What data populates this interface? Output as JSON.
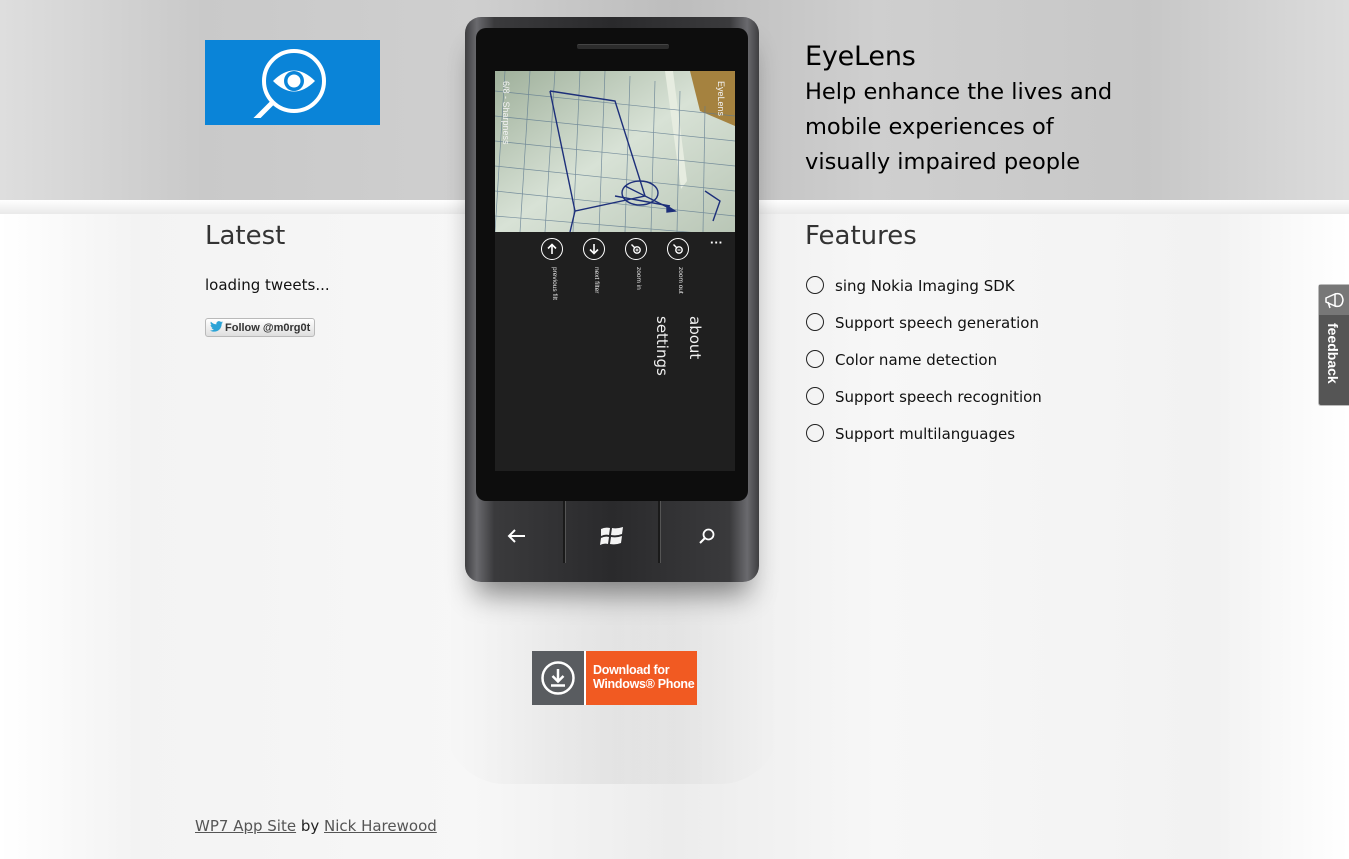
{
  "header": {
    "app_title": "EyeLens",
    "tagline": "Help enhance the lives and mobile experiences of visually impaired people"
  },
  "latest": {
    "heading": "Latest",
    "tweets_status": "loading tweets...",
    "follow_label": "Follow @m0rg0t"
  },
  "features": {
    "heading": "Features",
    "items": [
      "sing Nokia Imaging SDK",
      "Support speech generation",
      "Color name detection",
      "Support speech recognition",
      "Support multilanguages"
    ]
  },
  "phone": {
    "screen_app_name": "EyeLens",
    "screen_filter": "6/8 - Sharpness",
    "appbar": [
      {
        "label": "previous filt",
        "icon": "arrow-up-icon"
      },
      {
        "label": "next filter",
        "icon": "arrow-down-icon"
      },
      {
        "label": "zoom in",
        "icon": "zoom-in-icon"
      },
      {
        "label": "zoom out",
        "icon": "zoom-out-icon"
      }
    ],
    "menu": [
      "about",
      "settings"
    ],
    "hardware_buttons": [
      "back-arrow-icon",
      "windows-logo-icon",
      "search-icon"
    ]
  },
  "download": {
    "line1": "Download for",
    "line2": "Windows® Phone"
  },
  "footer": {
    "site_link": "WP7 App Site",
    "by": " by ",
    "author_link": "Nick Harewood"
  },
  "feedback": {
    "label": "feedback"
  },
  "colors": {
    "logo_blue": "#0a84d8",
    "download_orange": "#f15a22",
    "download_gray": "#595c60"
  }
}
